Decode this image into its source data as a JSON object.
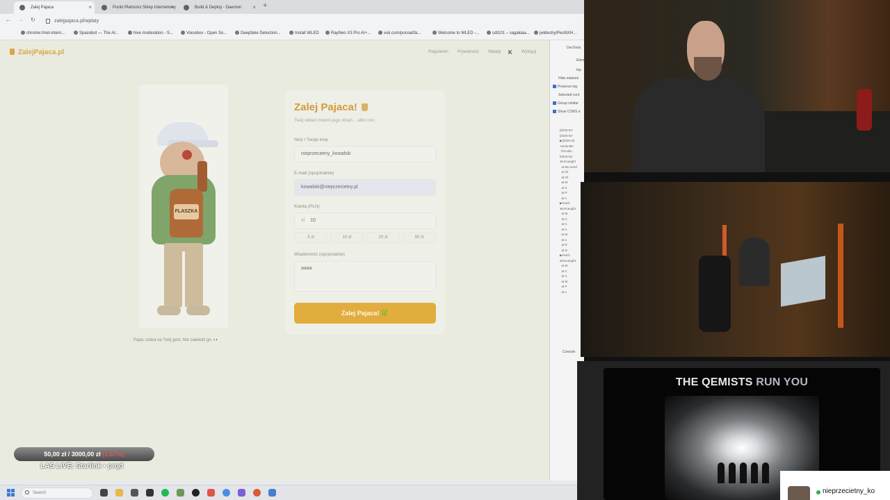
{
  "browser": {
    "tabs": [
      {
        "label": "Zalej Pajaca"
      },
      {
        "label": "Punkt Płatności Sklep Internetowy"
      },
      {
        "label": "Build & Deploy - Daemon"
      }
    ],
    "url": "zalejpajaca.pl/wplaty",
    "bookmarks": [
      "chrome://net-intern...",
      "Spacebot — The AI...",
      "hive moderation - S...",
      "Voicebox - Open So...",
      "Deepfake Detection...",
      "Install WLED",
      "RayNeo X3 Pro AI+...",
      "vuk.com/pocoal/fa...",
      "Welcome to WLED -...",
      "cdt101 – sagakiaa...",
      "jwldestry/PeoNXH..."
    ]
  },
  "site": {
    "logo": "ZalejPajaca.pl",
    "nav": [
      "Regulamin",
      "Prywatność",
      "Wpłaty",
      "Wyloguj"
    ],
    "nav_k": "K",
    "illustration_label": "FLASZKA",
    "illustration_caption": "Pajac czeka na Twój gest. Nie zawiedź go. 👀"
  },
  "form": {
    "title": "Zalej Pajaca!",
    "subtitle": "Twój wkład zmieni jego dzień... albo noc.",
    "nick_label": "Nick / Twoje imię",
    "nick_value": "nieprzecietny_kowalski",
    "email_label": "E-mail (opcjonalnie)",
    "email_value": "kowalski@nieprzecietny.pl",
    "amount_label": "Kwota (PLN)",
    "currency": "zł",
    "amount_value": "10",
    "presets": [
      "5 zł",
      "10 zł",
      "20 zł",
      "50 zł"
    ],
    "message_label": "Wiadomość (opcjonalnie)",
    "message_value": "aaaa",
    "submit_label": "Zalej Pajaca! 🍀"
  },
  "devtools": {
    "lines": [
      "DevTools",
      "Elem",
      "top",
      "Hide network",
      "Preserve log",
      "Selected cont",
      "Group similar",
      "Show CORS e",
      "Console"
    ],
    "stack": "[2026-03-\n[2026-03-\n▶[2026-03\n terminale\n 't1/code...\n[2026-03-\n⊗Uncaught\n  at Mo.send\n  at Gf\n  at Gf\n  at M\n  at S\n  at P\n  at o\n▶Fetch\n⊗Uncaught\n  at M\n  at C\n  at C\n  at C\n  at M\n  at o\n  at R\n  at D\n▶Fetch\n⊗Uncaught\n  at M\n  at C\n  at C\n  at M\n  at P\n  at o"
  },
  "taskbar": {
    "search_placeholder": "Search"
  },
  "overlay": {
    "donation_current": "50,00 zł",
    "donation_goal": "3000,00 zł",
    "donation_percent": "(1.67%)",
    "live_text": "LAS LIVE: Starlink • prqd"
  },
  "music": {
    "title_a": "THE QEMISTS",
    "title_b": "RUN YOU"
  },
  "viewer": {
    "name": "nieprzecietny_ko"
  },
  "colors": {
    "accent": "#e1ad3e",
    "title": "#d39a3a",
    "error": "#c0392b"
  }
}
